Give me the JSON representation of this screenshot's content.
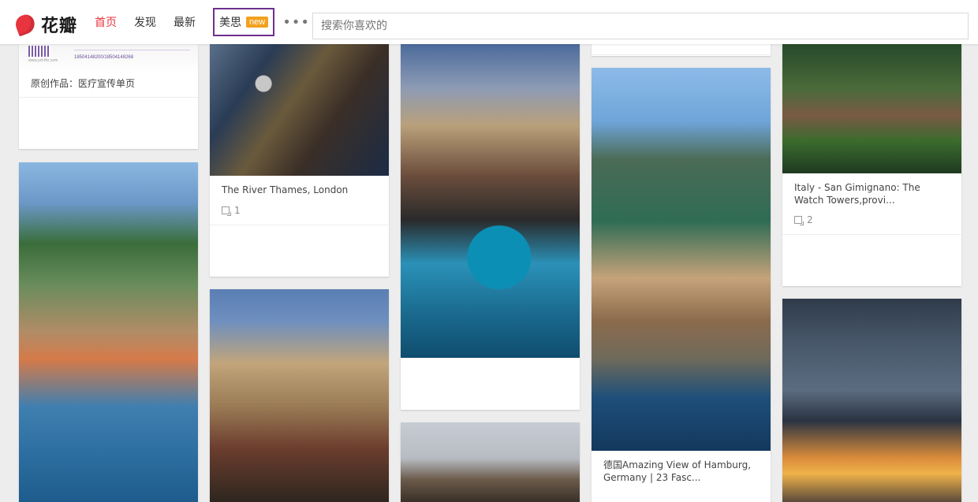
{
  "brand": {
    "name": "花瓣",
    "logo_color": "#e8343f"
  },
  "nav": {
    "items": [
      {
        "label": "首页",
        "active": true
      },
      {
        "label": "发现",
        "active": false
      },
      {
        "label": "最新",
        "active": false
      },
      {
        "label": "美思",
        "active": false,
        "badge": "new"
      }
    ],
    "more_label": "•••"
  },
  "search": {
    "placeholder": "搜索你喜欢的",
    "value": ""
  },
  "pins": [
    {
      "caption": "原创作品：医疗宣传单页",
      "repins": "",
      "thumb_label": "18504148200/18504148268",
      "thumb_site": "www.yzt-tfci.com"
    },
    {
      "caption": "The River Thames, London",
      "repins": "1"
    },
    {
      "caption": "",
      "repins": ""
    },
    {
      "caption": "",
      "repins": ""
    },
    {
      "caption": "",
      "repins": ""
    },
    {
      "caption": "",
      "repins": ""
    },
    {
      "caption": "德国Amazing View of Hamburg, Germany | 23 Fasc...",
      "repins": ""
    },
    {
      "caption": "Italy - San Gimignano: The Watch Towers,provi...",
      "repins": "2"
    },
    {
      "caption": "",
      "repins": ""
    }
  ],
  "colors": {
    "accent_red": "#e8343f",
    "badge_orange": "#f2a11f",
    "highlight_purple": "#6f2f8f",
    "page_bg": "#ededed"
  }
}
